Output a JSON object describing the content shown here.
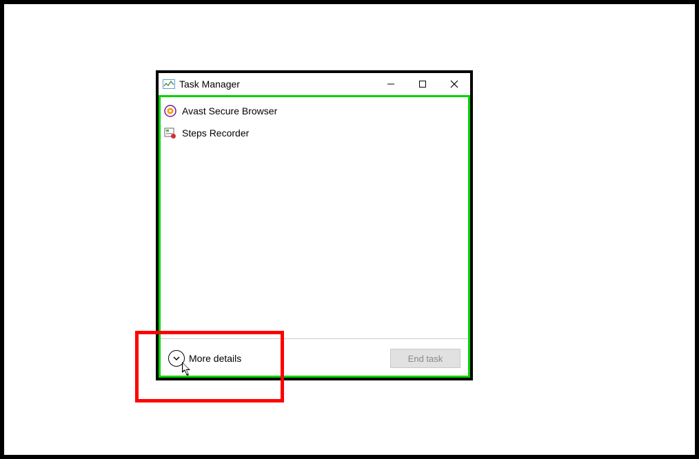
{
  "window": {
    "title": "Task Manager",
    "buttons": {
      "minimize": "minimize",
      "maximize": "maximize",
      "close": "close"
    }
  },
  "processes": [
    {
      "name": "Avast Secure Browser",
      "icon": "avast-browser-icon"
    },
    {
      "name": "Steps Recorder",
      "icon": "steps-recorder-icon"
    }
  ],
  "footer": {
    "more_details": "More details",
    "end_task": "End task",
    "end_task_enabled": false
  },
  "annotations": {
    "green_highlight": true,
    "red_highlight": true,
    "cursor_visible": true
  },
  "colors": {
    "green": "#00d400",
    "red": "#ff0000",
    "disabled_button_bg": "#e1e1e1",
    "disabled_button_text": "#888888"
  }
}
